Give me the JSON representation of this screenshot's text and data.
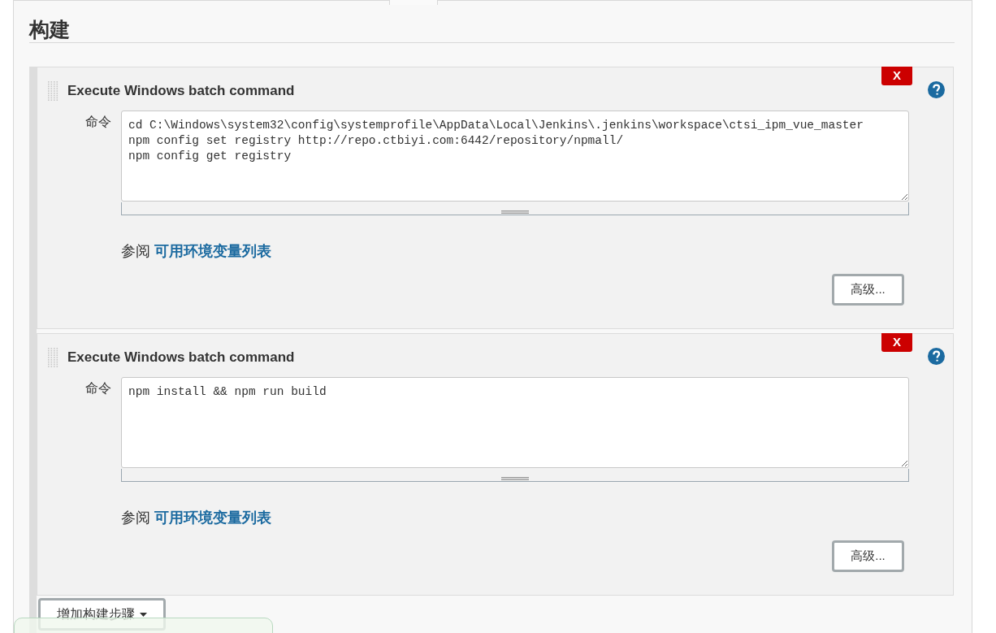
{
  "section": {
    "title": "构建"
  },
  "steps": [
    {
      "title": "Execute Windows batch command",
      "delete_label": "X",
      "field_label": "命令",
      "command": "cd C:\\Windows\\system32\\config\\systemprofile\\AppData\\Local\\Jenkins\\.jenkins\\workspace\\ctsi_ipm_vue_master\nnpm config set registry http://repo.ctbiyi.com:6442/repository/npmall/\nnpm config get registry",
      "see_also": "参阅",
      "link": "可用环境变量列表",
      "advanced_button": "高级..."
    },
    {
      "title": "Execute Windows batch command",
      "delete_label": "X",
      "field_label": "命令",
      "command": "npm install && npm run build",
      "see_also": "参阅",
      "link": "可用环境变量列表",
      "advanced_button": "高级..."
    }
  ],
  "add_step_button": "增加构建步骤"
}
